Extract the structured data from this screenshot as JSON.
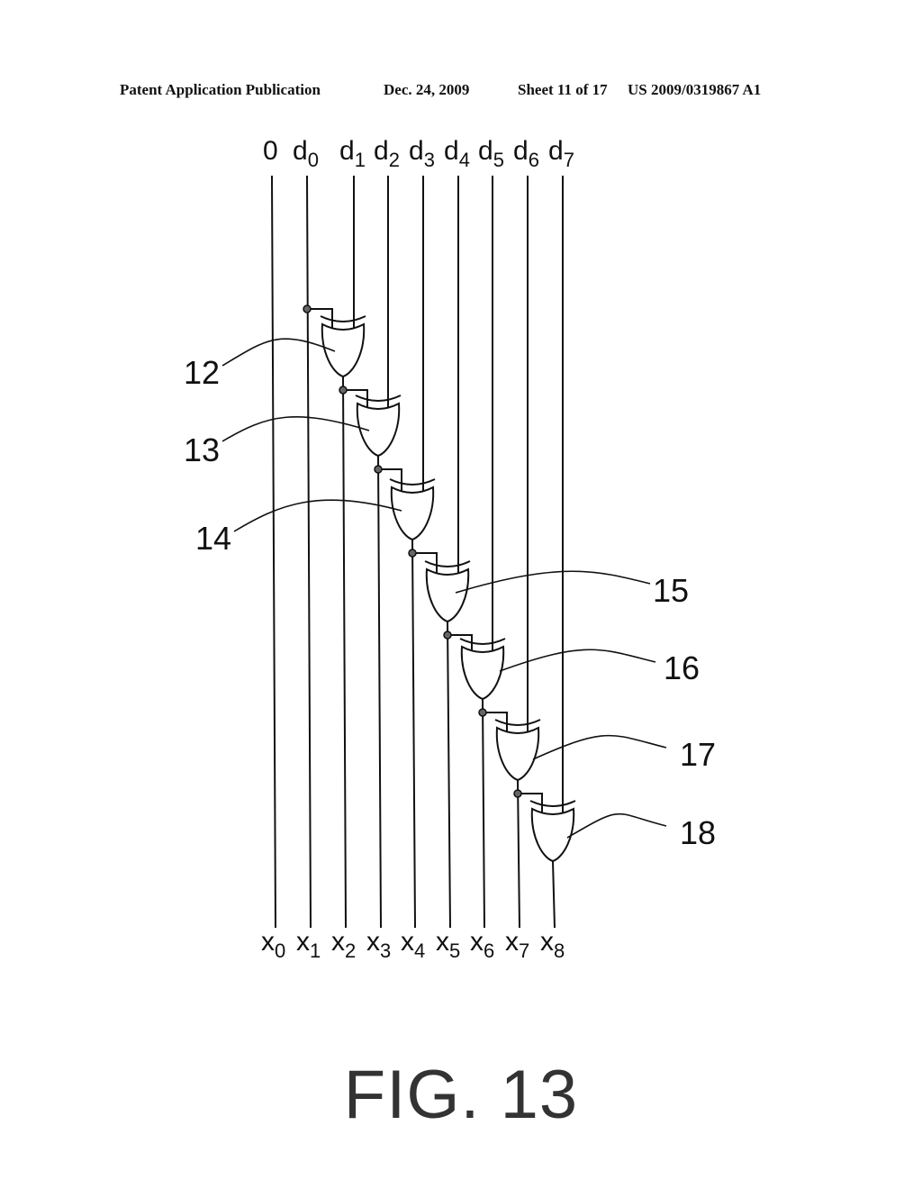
{
  "header": {
    "left": "Patent Application Publication",
    "date": "Dec. 24, 2009",
    "sheet": "Sheet 11 of 17",
    "pub_number": "US 2009/0319867 A1"
  },
  "diagram": {
    "inputs": [
      {
        "base": "0",
        "sub": ""
      },
      {
        "base": "d",
        "sub": "0"
      },
      {
        "base": "d",
        "sub": "1"
      },
      {
        "base": "d",
        "sub": "2"
      },
      {
        "base": "d",
        "sub": "3"
      },
      {
        "base": "d",
        "sub": "4"
      },
      {
        "base": "d",
        "sub": "5"
      },
      {
        "base": "d",
        "sub": "6"
      },
      {
        "base": "d",
        "sub": "7"
      }
    ],
    "outputs": [
      {
        "base": "x",
        "sub": "0"
      },
      {
        "base": "x",
        "sub": "1"
      },
      {
        "base": "x",
        "sub": "2"
      },
      {
        "base": "x",
        "sub": "3"
      },
      {
        "base": "x",
        "sub": "4"
      },
      {
        "base": "x",
        "sub": "5"
      },
      {
        "base": "x",
        "sub": "6"
      },
      {
        "base": "x",
        "sub": "7"
      },
      {
        "base": "x",
        "sub": "8"
      }
    ],
    "gate_type": "XOR",
    "gates": [
      {
        "ref": "12",
        "inputs": [
          "d0",
          "d1"
        ],
        "output": "x2"
      },
      {
        "ref": "13",
        "inputs": [
          "x2",
          "d2"
        ],
        "output": "x3"
      },
      {
        "ref": "14",
        "inputs": [
          "x3",
          "d3"
        ],
        "output": "x4"
      },
      {
        "ref": "15",
        "inputs": [
          "x4",
          "d4"
        ],
        "output": "x5"
      },
      {
        "ref": "16",
        "inputs": [
          "x5",
          "d5"
        ],
        "output": "x6"
      },
      {
        "ref": "17",
        "inputs": [
          "x6",
          "d6"
        ],
        "output": "x7"
      },
      {
        "ref": "18",
        "inputs": [
          "x7",
          "d7"
        ],
        "output": "x8"
      }
    ]
  },
  "figure_label": "FIG. 13"
}
